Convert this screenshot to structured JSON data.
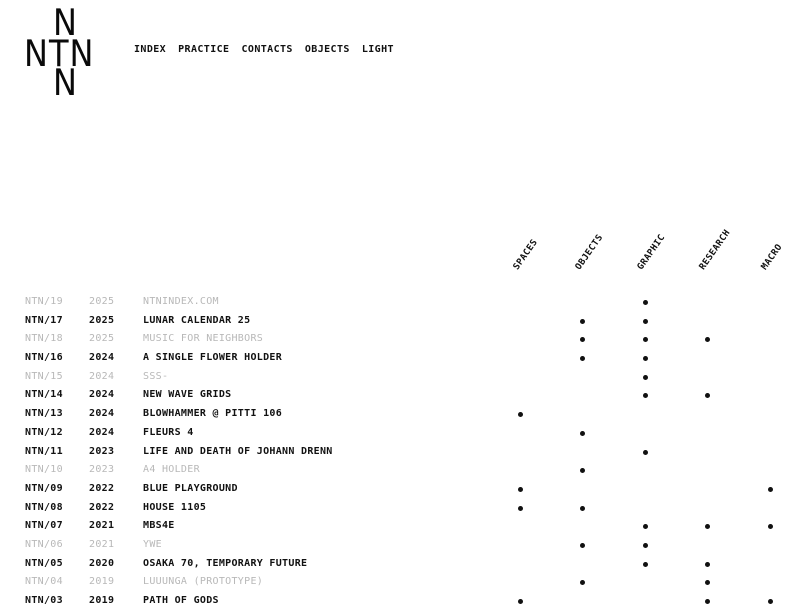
{
  "logo": {
    "top": "N",
    "middle": "NTN",
    "bottom": "N"
  },
  "nav": {
    "items": [
      {
        "label": "INDEX"
      },
      {
        "label": "PRACTICE"
      },
      {
        "label": "CONTACTS"
      },
      {
        "label": "OBJECTS"
      },
      {
        "label": "LIGHT"
      }
    ]
  },
  "columns": [
    {
      "key": "spaces",
      "label": "SPACES"
    },
    {
      "key": "objects",
      "label": "OBJECTS"
    },
    {
      "key": "graphic",
      "label": "GRAPHIC"
    },
    {
      "key": "research",
      "label": "RESEARCH"
    },
    {
      "key": "macro",
      "label": "MACRO"
    }
  ],
  "rows": [
    {
      "code": "NTN/19",
      "year": "2025",
      "title": "NTNINDEX.COM",
      "state": "dim",
      "tags": {
        "spaces": false,
        "objects": false,
        "graphic": true,
        "research": false,
        "macro": false
      }
    },
    {
      "code": "NTN/17",
      "year": "2025",
      "title": "LUNAR CALENDAR 25",
      "state": "active",
      "tags": {
        "spaces": false,
        "objects": true,
        "graphic": true,
        "research": false,
        "macro": false
      }
    },
    {
      "code": "NTN/18",
      "year": "2025",
      "title": "MUSIC FOR NEIGHBORS",
      "state": "dim",
      "tags": {
        "spaces": false,
        "objects": true,
        "graphic": true,
        "research": true,
        "macro": false
      }
    },
    {
      "code": "NTN/16",
      "year": "2024",
      "title": "A SINGLE FLOWER HOLDER",
      "state": "active",
      "tags": {
        "spaces": false,
        "objects": true,
        "graphic": true,
        "research": false,
        "macro": false
      }
    },
    {
      "code": "NTN/15",
      "year": "2024",
      "title": "SSS-",
      "state": "dim",
      "tags": {
        "spaces": false,
        "objects": false,
        "graphic": true,
        "research": false,
        "macro": false
      }
    },
    {
      "code": "NTN/14",
      "year": "2024",
      "title": "NEW WAVE GRIDS",
      "state": "active",
      "tags": {
        "spaces": false,
        "objects": false,
        "graphic": true,
        "research": true,
        "macro": false
      }
    },
    {
      "code": "NTN/13",
      "year": "2024",
      "title": "BLOWHAMMER @ PITTI 106",
      "state": "active",
      "tags": {
        "spaces": true,
        "objects": false,
        "graphic": false,
        "research": false,
        "macro": false
      }
    },
    {
      "code": "NTN/12",
      "year": "2024",
      "title": "FLEURS 4",
      "state": "active",
      "tags": {
        "spaces": false,
        "objects": true,
        "graphic": false,
        "research": false,
        "macro": false
      }
    },
    {
      "code": "NTN/11",
      "year": "2023",
      "title": "LIFE AND DEATH OF JOHANN DRENN",
      "state": "active",
      "tags": {
        "spaces": false,
        "objects": false,
        "graphic": true,
        "research": false,
        "macro": false
      }
    },
    {
      "code": "NTN/10",
      "year": "2023",
      "title": "A4 HOLDER",
      "state": "dim",
      "tags": {
        "spaces": false,
        "objects": true,
        "graphic": false,
        "research": false,
        "macro": false
      }
    },
    {
      "code": "NTN/09",
      "year": "2022",
      "title": "BLUE PLAYGROUND",
      "state": "active",
      "tags": {
        "spaces": true,
        "objects": false,
        "graphic": false,
        "research": false,
        "macro": true
      }
    },
    {
      "code": "NTN/08",
      "year": "2022",
      "title": "HOUSE 1105",
      "state": "active",
      "tags": {
        "spaces": true,
        "objects": true,
        "graphic": false,
        "research": false,
        "macro": false
      }
    },
    {
      "code": "NTN/07",
      "year": "2021",
      "title": "MBS4E",
      "state": "active",
      "tags": {
        "spaces": false,
        "objects": false,
        "graphic": true,
        "research": true,
        "macro": true
      }
    },
    {
      "code": "NTN/06",
      "year": "2021",
      "title": "YWE",
      "state": "dim",
      "tags": {
        "spaces": false,
        "objects": true,
        "graphic": true,
        "research": false,
        "macro": false
      }
    },
    {
      "code": "NTN/05",
      "year": "2020",
      "title": "OSAKA 70, TEMPORARY FUTURE",
      "state": "active",
      "tags": {
        "spaces": false,
        "objects": false,
        "graphic": true,
        "research": true,
        "macro": false
      }
    },
    {
      "code": "NTN/04",
      "year": "2019",
      "title": "LUUUNGA (PROTOTYPE)",
      "state": "dim",
      "tags": {
        "spaces": false,
        "objects": true,
        "graphic": false,
        "research": true,
        "macro": false
      }
    },
    {
      "code": "NTN/03",
      "year": "2019",
      "title": "PATH OF GODS",
      "state": "active",
      "tags": {
        "spaces": true,
        "objects": false,
        "graphic": false,
        "research": true,
        "macro": true
      }
    }
  ]
}
